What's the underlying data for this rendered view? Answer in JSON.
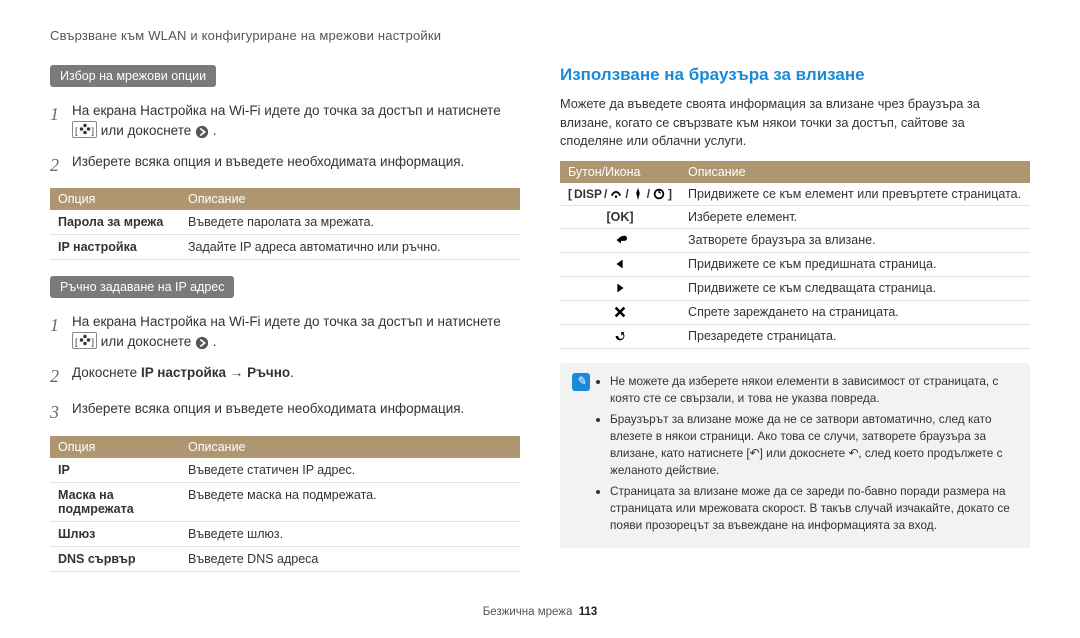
{
  "breadcrumb": "Свързване към WLAN и конфигуриране на мрежови настройки",
  "left": {
    "pill1": "Избор на мрежови опции",
    "step1a": "На екрана Настройка на Wi-Fi идете до точка за достъп и натиснете",
    "step1b": "или докоснете",
    "step1end": ".",
    "step2": "Изберете всяка опция и въведете необходимата информация.",
    "table1": {
      "h1": "Опция",
      "h2": "Описание",
      "rows": [
        {
          "k": "Парола за мрежа",
          "v": "Въведете паролата за мрежата."
        },
        {
          "k": "IP настройка",
          "v": "Задайте IP адреса автоматично или ръчно."
        }
      ]
    },
    "pill2": "Ръчно задаване на IP адрес",
    "step_m1a": "На екрана Настройка на Wi-Fi идете до точка за достъп и натиснете",
    "step_m1b": "или докоснете",
    "step_m1end": ".",
    "step_m2_pre": "Докоснете ",
    "step_m2_bold1": "IP настройка",
    "step_m2_arrow": " → ",
    "step_m2_bold2": "Ръчно",
    "step_m2_end": ".",
    "step_m3": "Изберете всяка опция и въведете необходимата информация.",
    "table2": {
      "h1": "Опция",
      "h2": "Описание",
      "rows": [
        {
          "k": "IP",
          "v": "Въведете статичен IP адрес."
        },
        {
          "k": "Маска на подмрежата",
          "v": "Въведете маска на подмрежата."
        },
        {
          "k": "Шлюз",
          "v": "Въведете шлюз."
        },
        {
          "k": "DNS сървър",
          "v": "Въведете DNS адреса"
        }
      ]
    }
  },
  "right": {
    "title": "Използване на браузъра за влизане",
    "para": "Можете да въведете своята информация за влизане чрез браузъра за влизане, когато се свързвате към някои точки за достъп, сайтове за споделяне или облачни услуги.",
    "table": {
      "h1": "Бутон/Икона",
      "h2": "Описание",
      "rows": [
        {
          "icon": "disp",
          "v": "Придвижете се към елемент или превъртете страницата."
        },
        {
          "icon": "ok",
          "v": "Изберете елемент."
        },
        {
          "icon": "back",
          "v": "Затворете браузъра за влизане."
        },
        {
          "icon": "left",
          "v": "Придвижете се към предишната страница."
        },
        {
          "icon": "right",
          "v": "Придвижете се към следващата страница."
        },
        {
          "icon": "stop",
          "v": "Спрете зареждането на страницата."
        },
        {
          "icon": "reload",
          "v": "Презаредете страницата."
        }
      ]
    },
    "disp_label": "DISP",
    "ok_label": "OK",
    "notes": [
      "Не можете да изберете някои елементи в зависимост от страницата, с която сте се свързали, и това не указва повреда.",
      "Браузърът за влизане може да не се затвори автоматично, след като влезете в някои страници. Ако това се случи, затворете браузъра за влизане, като натиснете [↶] или докоснете ↶, след което продължете с желаното действие.",
      "Страницата за влизане може да се зареди по-бавно поради размера на страницата или мрежовата скорост. В такъв случай изчакайте, докато се появи прозорецът за въвеждане на информацията за вход."
    ]
  },
  "footer": {
    "label": "Безжична мрежа",
    "page": "113"
  }
}
